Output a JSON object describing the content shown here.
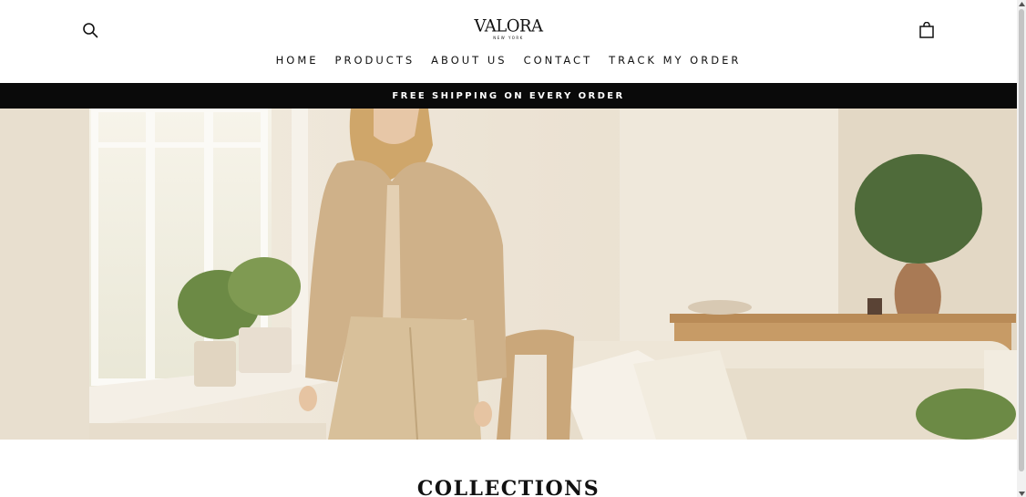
{
  "header": {
    "logo_main": "VALORA",
    "logo_sub": "NEW YORK",
    "search_icon": "search-icon",
    "cart_icon": "shopping-bag-icon"
  },
  "nav": {
    "items": [
      "HOME",
      "PRODUCTS",
      "ABOUT US",
      "CONTACT",
      "TRACK MY ORDER"
    ]
  },
  "announcement": {
    "text": "FREE SHIPPING ON EVERY ORDER",
    "background": "#0a0a0a",
    "color": "#ffffff"
  },
  "hero": {
    "image": "woman-in-beige-cardigan-living-room"
  },
  "collections": {
    "title": "COLLECTIONS"
  },
  "colors": {
    "page_bg": "#ffffff",
    "text": "#111111"
  }
}
